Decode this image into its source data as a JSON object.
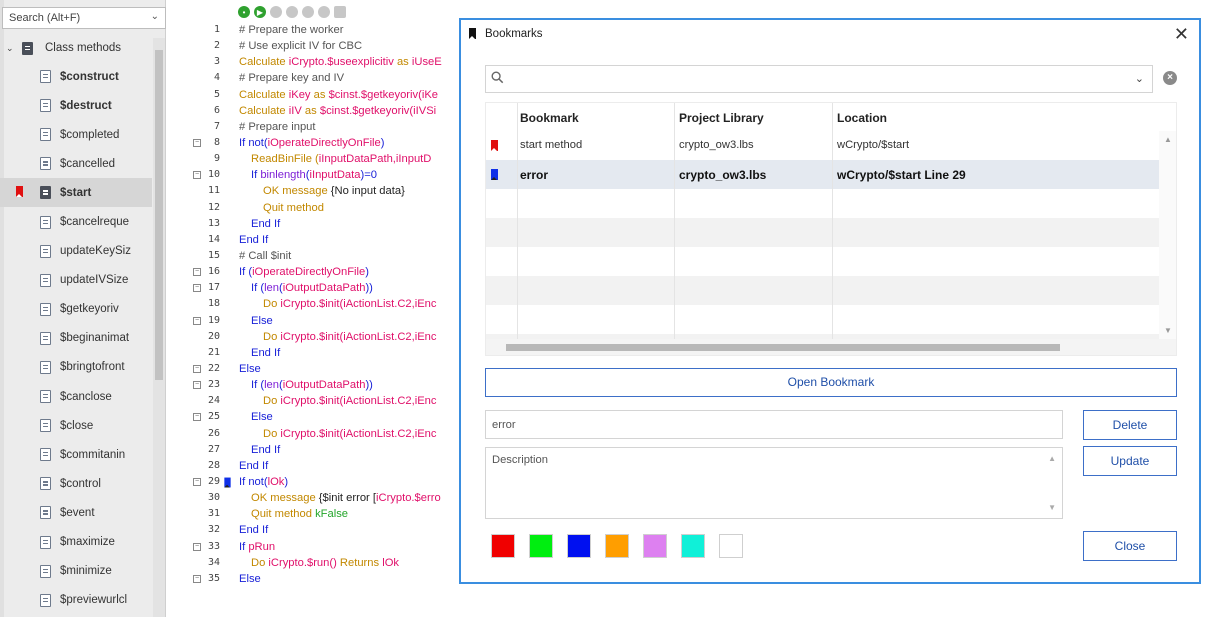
{
  "sidebar": {
    "search_placeholder": "Search (Alt+F)",
    "root_label": "Class methods",
    "methods": [
      {
        "label": "$construct",
        "bold": true,
        "bookmark": false,
        "selected": false
      },
      {
        "label": "$destruct",
        "bold": true,
        "bookmark": false,
        "selected": false
      },
      {
        "label": "$completed",
        "bold": false,
        "bookmark": false,
        "selected": false
      },
      {
        "label": "$cancelled",
        "bold": false,
        "bookmark": false,
        "selected": false
      },
      {
        "label": "$start",
        "bold": true,
        "bookmark": true,
        "selected": true
      },
      {
        "label": "$cancelreque",
        "bold": false,
        "bookmark": false,
        "selected": false
      },
      {
        "label": "updateKeySiz",
        "bold": false,
        "bookmark": false,
        "selected": false
      },
      {
        "label": "updateIVSize",
        "bold": false,
        "bookmark": false,
        "selected": false
      },
      {
        "label": "$getkeyoriv",
        "bold": false,
        "bookmark": false,
        "selected": false
      },
      {
        "label": "$beginanimat",
        "bold": false,
        "bookmark": false,
        "selected": false
      },
      {
        "label": "$bringtofront",
        "bold": false,
        "bookmark": false,
        "selected": false
      },
      {
        "label": "$canclose",
        "bold": false,
        "bookmark": false,
        "selected": false
      },
      {
        "label": "$close",
        "bold": false,
        "bookmark": false,
        "selected": false
      },
      {
        "label": "$commitanin",
        "bold": false,
        "bookmark": false,
        "selected": false
      },
      {
        "label": "$control",
        "bold": false,
        "bookmark": false,
        "selected": false
      },
      {
        "label": "$event",
        "bold": false,
        "bookmark": false,
        "selected": false
      },
      {
        "label": "$maximize",
        "bold": false,
        "bookmark": false,
        "selected": false
      },
      {
        "label": "$minimize",
        "bold": false,
        "bookmark": false,
        "selected": false
      },
      {
        "label": "$previewurlcl",
        "bold": false,
        "bookmark": false,
        "selected": false
      }
    ]
  },
  "editor": {
    "lines": [
      {
        "n": "1",
        "fold": false,
        "bookmark": "",
        "indent": 0,
        "parts": [
          [
            "c-comment",
            "# Prepare the worker"
          ]
        ]
      },
      {
        "n": "2",
        "fold": false,
        "bookmark": "",
        "indent": 0,
        "parts": [
          [
            "c-comment",
            "# Use explicit IV for CBC"
          ]
        ]
      },
      {
        "n": "3",
        "fold": false,
        "bookmark": "",
        "indent": 0,
        "parts": [
          [
            "c-func",
            "Calculate "
          ],
          [
            "c-var",
            "iCrypto.$useexplicitiv"
          ],
          [
            "c-func",
            " as "
          ],
          [
            "c-var",
            "iUseE"
          ]
        ]
      },
      {
        "n": "4",
        "fold": false,
        "bookmark": "",
        "indent": 0,
        "parts": [
          [
            "c-comment",
            "# Prepare key and IV"
          ]
        ]
      },
      {
        "n": "5",
        "fold": false,
        "bookmark": "",
        "indent": 0,
        "parts": [
          [
            "c-func",
            "Calculate "
          ],
          [
            "c-var",
            "iKey"
          ],
          [
            "c-func",
            " as "
          ],
          [
            "c-var",
            "$cinst.$getkeyoriv("
          ],
          [
            "c-var",
            "iKe"
          ]
        ]
      },
      {
        "n": "6",
        "fold": false,
        "bookmark": "",
        "indent": 0,
        "parts": [
          [
            "c-func",
            "Calculate "
          ],
          [
            "c-var",
            "iIV"
          ],
          [
            "c-func",
            " as "
          ],
          [
            "c-var",
            "$cinst.$getkeyoriv("
          ],
          [
            "c-var",
            "iIVSi"
          ]
        ]
      },
      {
        "n": "7",
        "fold": false,
        "bookmark": "",
        "indent": 0,
        "parts": [
          [
            "c-comment",
            "# Prepare input"
          ]
        ]
      },
      {
        "n": "8",
        "fold": true,
        "bookmark": "",
        "indent": 0,
        "parts": [
          [
            "c-kw",
            "If not("
          ],
          [
            "c-var",
            "iOperateDirectlyOnFile"
          ],
          [
            "c-kw",
            ")"
          ]
        ]
      },
      {
        "n": "9",
        "fold": false,
        "bookmark": "",
        "indent": 1,
        "parts": [
          [
            "c-func",
            "ReadBinFile ("
          ],
          [
            "c-var",
            "iInputDataPath,iInputD"
          ]
        ]
      },
      {
        "n": "10",
        "fold": true,
        "bookmark": "",
        "indent": 1,
        "parts": [
          [
            "c-kw",
            "If "
          ],
          [
            "c-meth",
            "binlength"
          ],
          [
            "c-kw",
            "("
          ],
          [
            "c-var",
            "iInputData"
          ],
          [
            "c-kw",
            ")=0"
          ]
        ]
      },
      {
        "n": "11",
        "fold": false,
        "bookmark": "",
        "indent": 2,
        "parts": [
          [
            "c-func",
            "OK message "
          ],
          [
            "c-plain",
            "{No input data}"
          ]
        ]
      },
      {
        "n": "12",
        "fold": false,
        "bookmark": "",
        "indent": 2,
        "parts": [
          [
            "c-func",
            "Quit method"
          ]
        ]
      },
      {
        "n": "13",
        "fold": false,
        "bookmark": "",
        "indent": 1,
        "parts": [
          [
            "c-kw",
            "End If"
          ]
        ]
      },
      {
        "n": "14",
        "fold": false,
        "bookmark": "",
        "indent": 0,
        "parts": [
          [
            "c-kw",
            "End If"
          ]
        ]
      },
      {
        "n": "15",
        "fold": false,
        "bookmark": "",
        "indent": 0,
        "parts": [
          [
            "c-comment",
            "# Call $init"
          ]
        ]
      },
      {
        "n": "16",
        "fold": true,
        "bookmark": "",
        "indent": 0,
        "parts": [
          [
            "c-kw",
            "If ("
          ],
          [
            "c-var",
            "iOperateDirectlyOnFile"
          ],
          [
            "c-kw",
            ")"
          ]
        ]
      },
      {
        "n": "17",
        "fold": true,
        "bookmark": "",
        "indent": 1,
        "parts": [
          [
            "c-kw",
            "If ("
          ],
          [
            "c-meth",
            "len"
          ],
          [
            "c-kw",
            "("
          ],
          [
            "c-var",
            "iOutputDataPath"
          ],
          [
            "c-kw",
            "))"
          ]
        ]
      },
      {
        "n": "18",
        "fold": false,
        "bookmark": "",
        "indent": 2,
        "parts": [
          [
            "c-func",
            "Do "
          ],
          [
            "c-var",
            "iCrypto.$init("
          ],
          [
            "c-var",
            "iActionList.C2,iEnc"
          ]
        ]
      },
      {
        "n": "19",
        "fold": true,
        "bookmark": "",
        "indent": 1,
        "parts": [
          [
            "c-kw",
            "Else"
          ]
        ]
      },
      {
        "n": "20",
        "fold": false,
        "bookmark": "",
        "indent": 2,
        "parts": [
          [
            "c-func",
            "Do "
          ],
          [
            "c-var",
            "iCrypto.$init("
          ],
          [
            "c-var",
            "iActionList.C2,iEnc"
          ]
        ]
      },
      {
        "n": "21",
        "fold": false,
        "bookmark": "",
        "indent": 1,
        "parts": [
          [
            "c-kw",
            "End If"
          ]
        ]
      },
      {
        "n": "22",
        "fold": true,
        "bookmark": "",
        "indent": 0,
        "parts": [
          [
            "c-kw",
            "Else"
          ]
        ]
      },
      {
        "n": "23",
        "fold": true,
        "bookmark": "",
        "indent": 1,
        "parts": [
          [
            "c-kw",
            "If ("
          ],
          [
            "c-meth",
            "len"
          ],
          [
            "c-kw",
            "("
          ],
          [
            "c-var",
            "iOutputDataPath"
          ],
          [
            "c-kw",
            "))"
          ]
        ]
      },
      {
        "n": "24",
        "fold": false,
        "bookmark": "",
        "indent": 2,
        "parts": [
          [
            "c-func",
            "Do "
          ],
          [
            "c-var",
            "iCrypto.$init("
          ],
          [
            "c-var",
            "iActionList.C2,iEnc"
          ]
        ]
      },
      {
        "n": "25",
        "fold": true,
        "bookmark": "",
        "indent": 1,
        "parts": [
          [
            "c-kw",
            "Else"
          ]
        ]
      },
      {
        "n": "26",
        "fold": false,
        "bookmark": "",
        "indent": 2,
        "parts": [
          [
            "c-func",
            "Do "
          ],
          [
            "c-var",
            "iCrypto.$init("
          ],
          [
            "c-var",
            "iActionList.C2,iEnc"
          ]
        ]
      },
      {
        "n": "27",
        "fold": false,
        "bookmark": "",
        "indent": 1,
        "parts": [
          [
            "c-kw",
            "End If"
          ]
        ]
      },
      {
        "n": "28",
        "fold": false,
        "bookmark": "",
        "indent": 0,
        "parts": [
          [
            "c-kw",
            "End If"
          ]
        ]
      },
      {
        "n": "29",
        "fold": true,
        "bookmark": "blue",
        "indent": 0,
        "parts": [
          [
            "c-kw",
            "If not("
          ],
          [
            "c-var",
            "lOk"
          ],
          [
            "c-kw",
            ")"
          ]
        ]
      },
      {
        "n": "30",
        "fold": false,
        "bookmark": "",
        "indent": 1,
        "parts": [
          [
            "c-func",
            "OK message "
          ],
          [
            "c-plain",
            "{$init error ["
          ],
          [
            "c-var",
            "iCrypto.$erro"
          ]
        ]
      },
      {
        "n": "31",
        "fold": false,
        "bookmark": "",
        "indent": 1,
        "parts": [
          [
            "c-func",
            "Quit method "
          ],
          [
            "c-const",
            "kFalse"
          ]
        ]
      },
      {
        "n": "32",
        "fold": false,
        "bookmark": "",
        "indent": 0,
        "parts": [
          [
            "c-kw",
            "End If"
          ]
        ]
      },
      {
        "n": "33",
        "fold": true,
        "bookmark": "",
        "indent": 0,
        "parts": [
          [
            "c-kw",
            "If "
          ],
          [
            "c-var",
            "pRun"
          ]
        ]
      },
      {
        "n": "34",
        "fold": false,
        "bookmark": "",
        "indent": 1,
        "parts": [
          [
            "c-func",
            "Do "
          ],
          [
            "c-var",
            "iCrypto.$run()"
          ],
          [
            "c-func",
            " Returns "
          ],
          [
            "c-var",
            "lOk"
          ]
        ]
      },
      {
        "n": "35",
        "fold": true,
        "bookmark": "",
        "indent": 0,
        "parts": [
          [
            "c-kw",
            "Else"
          ]
        ]
      }
    ]
  },
  "dialog": {
    "title": "Bookmarks",
    "close_glyph": "✕",
    "search_value": "",
    "columns": [
      "Bookmark",
      "Project Library",
      "Location"
    ],
    "rows": [
      {
        "bookmark": "start method",
        "library": "crypto_ow3.lbs",
        "location": "wCrypto/$start",
        "color": "red",
        "selected": false
      },
      {
        "bookmark": "error",
        "library": "crypto_ow3.lbs",
        "location": "wCrypto/$start Line 29",
        "color": "blue",
        "selected": true
      }
    ],
    "empty_rows": 5,
    "open_button": "Open Bookmark",
    "name_value": "error",
    "description_placeholder": "Description",
    "delete_button": "Delete",
    "update_button": "Update",
    "close_button": "Close",
    "swatches": [
      "#f00000",
      "#00ee10",
      "#0010f0",
      "#ff9e00",
      "#dd80f0",
      "#10f0d8",
      "#ffffff"
    ]
  }
}
